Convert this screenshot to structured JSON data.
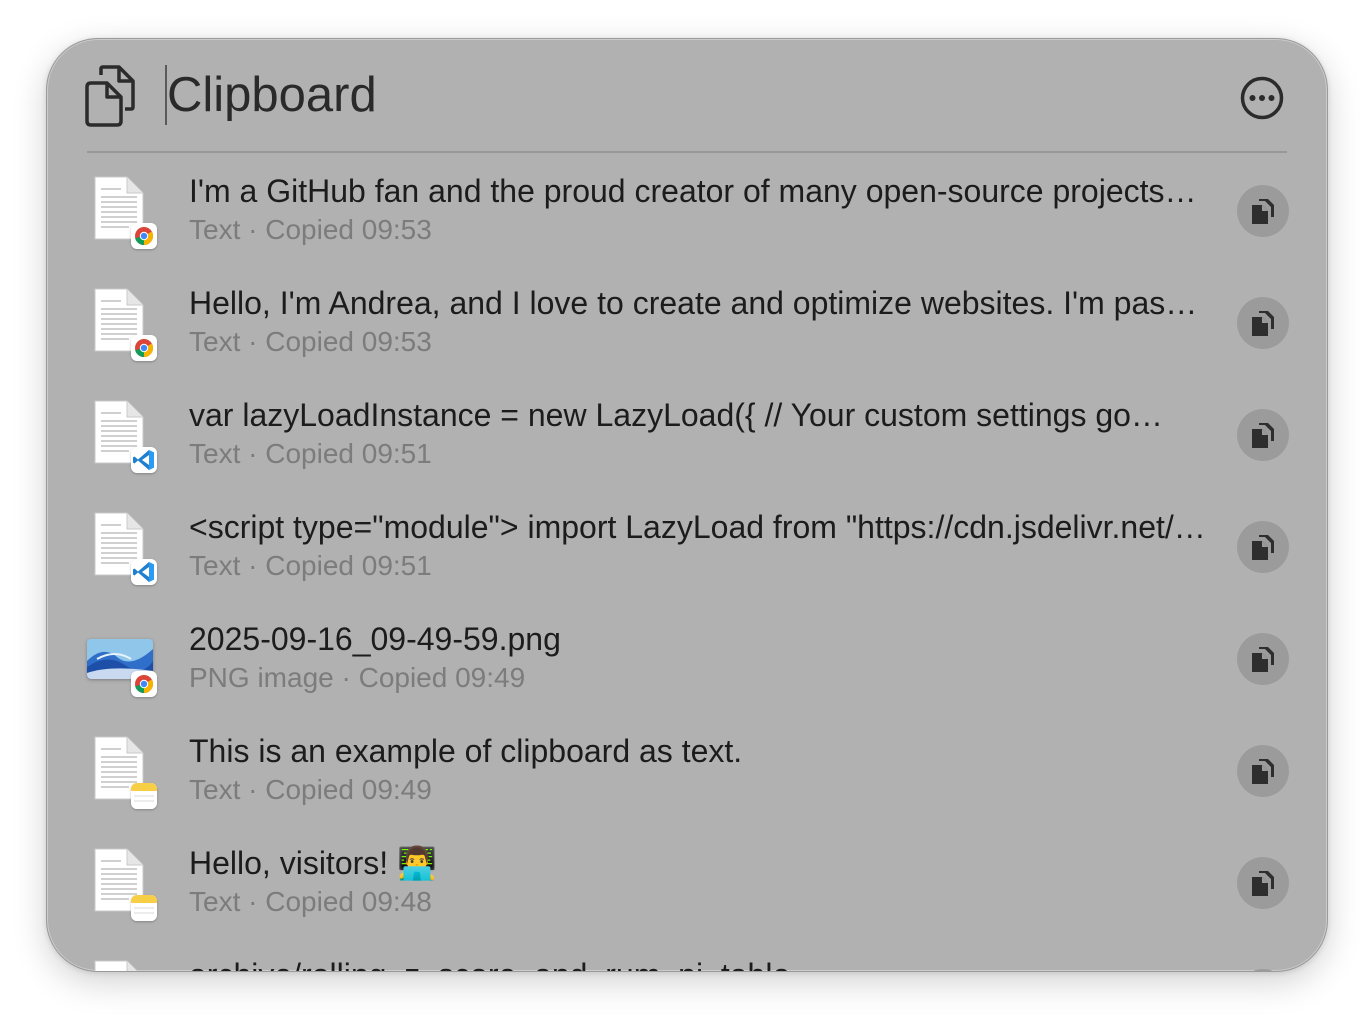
{
  "header": {
    "app_icon": "clipboard-icon",
    "search_value": "Clipboard",
    "more_icon": "ellipsis-circle-icon"
  },
  "items": [
    {
      "title": "I'm a GitHub fan and the proud creator of many open-source projects…",
      "subtitle": "Text · Copied 09:53",
      "thumb": "text-document",
      "badge": "chrome"
    },
    {
      "title": "Hello, I'm Andrea, and I love to create and optimize websites. I'm passionate…",
      "subtitle": "Text · Copied 09:53",
      "thumb": "text-document",
      "badge": "chrome"
    },
    {
      "title": "var lazyLoadInstance = new LazyLoad({ // Your custom settings go…",
      "subtitle": "Text · Copied 09:51",
      "thumb": "text-document",
      "badge": "vscode"
    },
    {
      "title": "<script type=\"module\"> import LazyLoad from \"https://cdn.jsdelivr.net/npm/vanilla-lazyload…",
      "subtitle": "Text · Copied 09:51",
      "thumb": "text-document",
      "badge": "vscode"
    },
    {
      "title": "2025-09-16_09-49-59.png",
      "subtitle": "PNG image · Copied 09:49",
      "thumb": "image",
      "badge": "chrome"
    },
    {
      "title": "This is an example of clipboard as text.",
      "subtitle": "Text · Copied 09:49",
      "thumb": "text-document",
      "badge": "notes"
    },
    {
      "title": "Hello, visitors! 👨‍💻",
      "subtitle": "Text · Copied 09:48",
      "thumb": "text-document",
      "badge": "notes"
    },
    {
      "title": "archive/rolling_z_score_and_rum_pi_table",
      "subtitle": "",
      "thumb": "text-document",
      "badge": "notes"
    }
  ],
  "row_action_icon": "copy-documents-icon",
  "colors": {
    "panel": "#b1b1b1",
    "title_text": "#1c1c1c",
    "subtitle_text": "#7c7c7c",
    "copy_button": "#9b9b9b"
  }
}
